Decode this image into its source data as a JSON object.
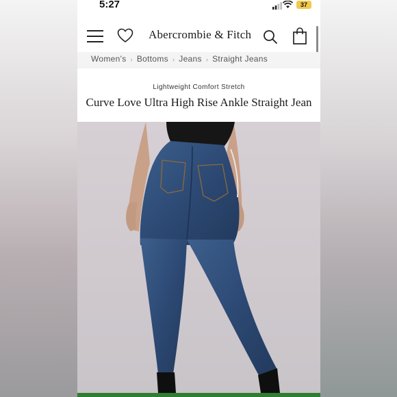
{
  "status_bar": {
    "time": "5:27",
    "battery": "37"
  },
  "nav": {
    "logo": "Abercrombie & Fitch",
    "icons": [
      "menu-icon",
      "heart-icon",
      "search-icon",
      "bag-icon"
    ]
  },
  "breadcrumb": {
    "items": [
      "Women's",
      "Bottoms",
      "Jeans",
      "Straight Jeans"
    ]
  },
  "product": {
    "subtitle": "Lightweight Comfort Stretch",
    "title": "Curve Love Ultra High Rise Ankle Straight Jean",
    "image_subject": "model wearing dark wash straight jeans, back view"
  },
  "colors": {
    "accent_bar": "#2e7d32",
    "denim": "#2f4f7a",
    "battery": "#f2c94c"
  }
}
